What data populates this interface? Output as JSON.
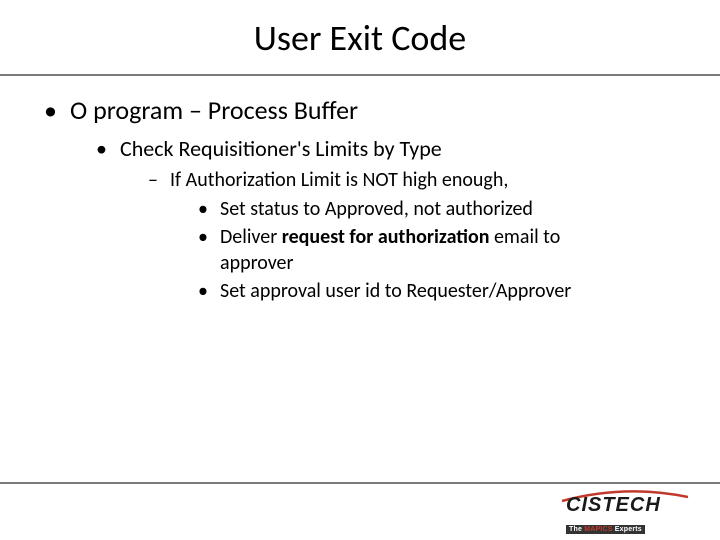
{
  "title": "User Exit Code",
  "bullets": {
    "l1_1": "O program – Process Buffer",
    "l2_1": "Check Requisitioner's Limits by Type",
    "l3_1": "If Authorization Limit is NOT high enough,",
    "l4_1": "Set status to Approved, not authorized",
    "l4_2a": "Deliver ",
    "l4_2b_bold": "request for authorization",
    "l4_2c": " email to approver",
    "l4_3": "Set approval user id to Requester/Approver"
  },
  "logo": {
    "name": "CISTECH",
    "tagline_prefix": "The ",
    "tagline_brand": "MAPICS",
    "tagline_suffix": " Experts"
  }
}
